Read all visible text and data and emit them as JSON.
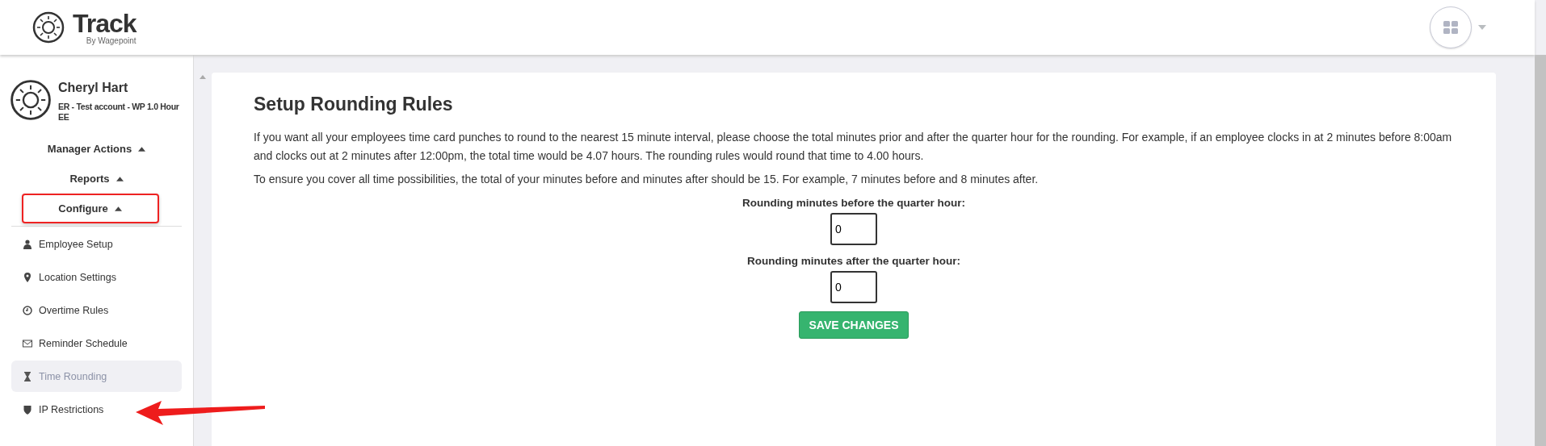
{
  "header": {
    "brand": "Track",
    "brand_sub": "By Wagepoint"
  },
  "user": {
    "name": "Cheryl Hart",
    "company_lines": [
      "ER - Test account - WP 1.0 Hour",
      "EE"
    ]
  },
  "sections": [
    {
      "label": "Manager Actions",
      "expanded": true,
      "highlighted": false
    },
    {
      "label": "Reports",
      "expanded": true,
      "highlighted": false
    },
    {
      "label": "Configure",
      "expanded": true,
      "highlighted": true
    }
  ],
  "menu": [
    {
      "label": "Employee Setup",
      "kind": "person",
      "selected": false,
      "pointed": false
    },
    {
      "label": "Location Settings",
      "kind": "pin",
      "selected": false,
      "pointed": false
    },
    {
      "label": "Overtime Rules",
      "kind": "clock",
      "selected": false,
      "pointed": false
    },
    {
      "label": "Reminder Schedule",
      "kind": "envelope",
      "selected": false,
      "pointed": false
    },
    {
      "label": "Time Rounding",
      "kind": "hourglass",
      "selected": true,
      "pointed": false
    },
    {
      "label": "IP Restrictions",
      "kind": "shield",
      "selected": false,
      "pointed": true
    }
  ],
  "main": {
    "title": "Setup Rounding Rules",
    "paragraphs": [
      "If you want all your employees time card punches to round to the nearest 15 minute interval, please choose the total minutes prior and after the quarter hour for the rounding. For example, if an employee clocks in at 2 minutes before 8:00am and clocks out at 2 minutes after 12:00pm, the total time would be 4.07 hours. The rounding rules would round that time to 4.00 hours.",
      "To ensure you cover all time possibilities, the total of your minutes before and minutes after should be 15. For example, 7 minutes before and 8 minutes after."
    ],
    "fields": [
      {
        "label": "Rounding minutes before the quarter hour:",
        "value": "0"
      },
      {
        "label": "Rounding minutes after the quarter hour:",
        "value": "0"
      }
    ],
    "button": "SAVE CHANGES"
  }
}
